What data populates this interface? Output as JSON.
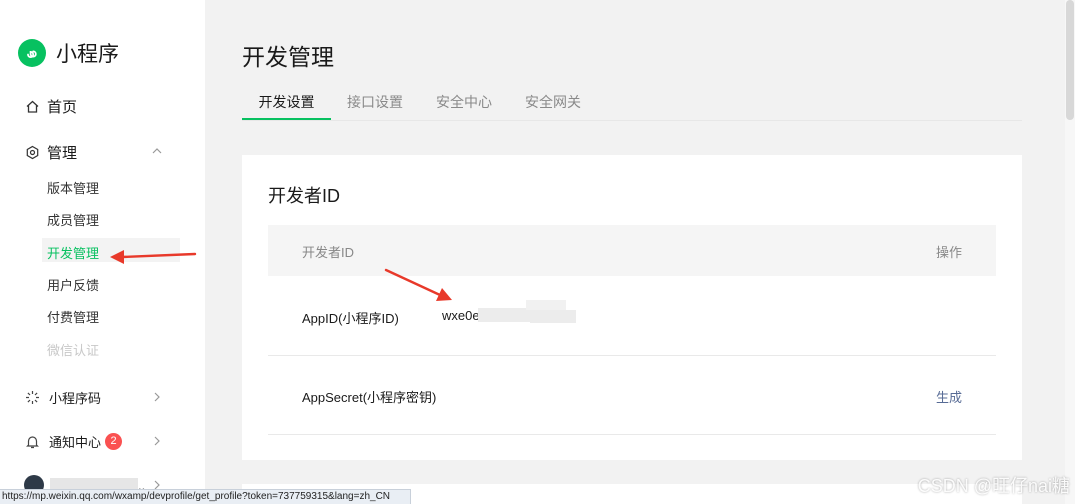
{
  "app": {
    "name": "小程序",
    "brand_color": "#07c160"
  },
  "sidebar": {
    "home": "首页",
    "manage": "管理",
    "manage_items": [
      "版本管理",
      "成员管理",
      "开发管理",
      "用户反馈",
      "付费管理",
      "微信认证"
    ],
    "active_item": "开发管理",
    "miniprogram_code": "小程序码",
    "notification_center": "通知中心",
    "notification_count": "2",
    "user_name_suffix": ".."
  },
  "page": {
    "title": "开发管理",
    "tabs": [
      "开发设置",
      "接口设置",
      "安全中心",
      "安全网关"
    ],
    "active_tab": "开发设置"
  },
  "card": {
    "title": "开发者ID",
    "columns": [
      "开发者ID",
      "操作"
    ],
    "rows": [
      {
        "label": "AppID(小程序ID)",
        "value": "wxe0e",
        "action": ""
      },
      {
        "label": "AppSecret(小程序密钥)",
        "value": "",
        "action": "生成"
      }
    ]
  },
  "status_bar": {
    "url": "https://mp.weixin.qq.com/wxamp/devprofile/get_profile?token=737759315&lang=zh_CN"
  },
  "watermark": "CSDN @旺仔nai糖",
  "annotation_color": "#e8392a"
}
